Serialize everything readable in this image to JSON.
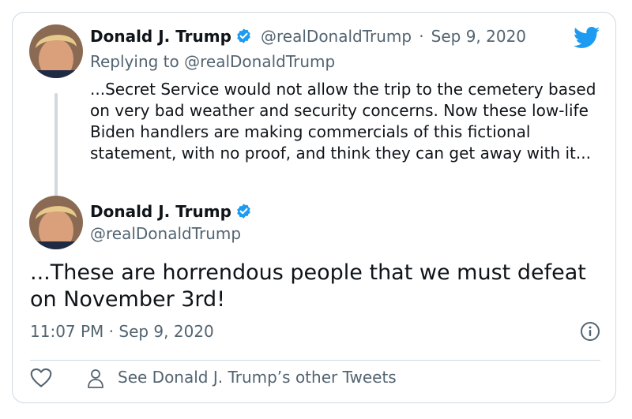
{
  "tweet_parent": {
    "author_name": "Donald J. Trump",
    "handle": "@realDonaldTrump",
    "separator": "·",
    "date": "Sep 9, 2020",
    "replying_to": "Replying to @realDonaldTrump",
    "text": "...Secret Service would not allow the trip to the cemetery based on very bad weather and security concerns. Now these low-life Biden handlers are making commercials of this fictional statement, with no proof, and think they can get away with it..."
  },
  "tweet_main": {
    "author_name": "Donald J. Trump",
    "handle": "@realDonaldTrump",
    "text": "...These are horrendous people that we must defeat on November 3rd!",
    "timestamp": "11:07 PM · Sep 9, 2020"
  },
  "footer": {
    "other_tweets_label": "See Donald J. Trump’s other Tweets"
  },
  "icons": {
    "brand": "twitter-bird-icon",
    "verified": "verified-badge-icon",
    "info": "info-icon",
    "like": "heart-icon",
    "person": "person-icon"
  },
  "colors": {
    "twitter_blue": "#1d9bf0",
    "text": "#0f1419",
    "muted": "#536471",
    "border": "#cfd9de"
  }
}
